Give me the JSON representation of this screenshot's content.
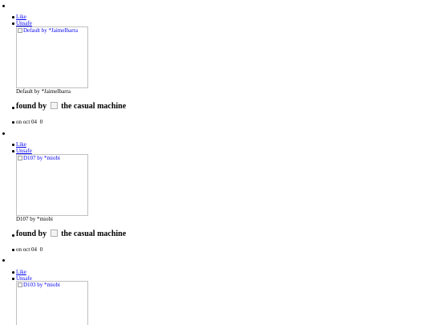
{
  "items": [
    {
      "like_label": "Like",
      "unsafe_label": "Unsafe",
      "image_alt": "Default by *JaimeIbarra",
      "caption": "Default by *JaimeIbarra",
      "found_prefix": "found by",
      "finder_name": "the casual machine",
      "date_text": "on oct 04",
      "count": "0"
    },
    {
      "like_label": "Like",
      "unsafe_label": "Unsafe",
      "image_alt": "D107 by *miobi",
      "caption": "D107 by *miobi",
      "found_prefix": "found by",
      "finder_name": "the casual machine",
      "date_text": "on oct 04",
      "count": "0"
    },
    {
      "like_label": "Like",
      "unsafe_label": "Unsafe",
      "image_alt": "D103 by *miobi"
    }
  ]
}
